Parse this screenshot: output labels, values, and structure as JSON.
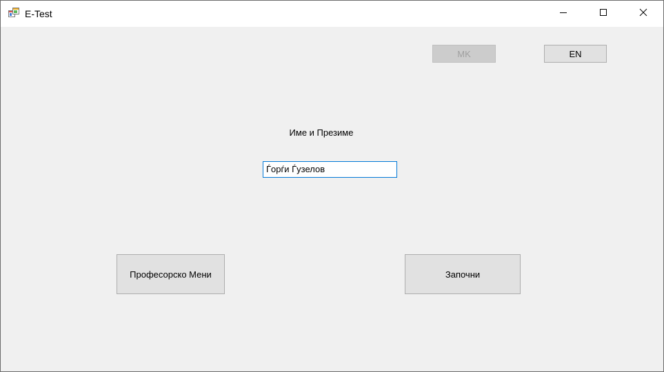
{
  "window": {
    "title": "E-Test",
    "icons": {
      "app": "windows-form-icon",
      "minimize": "minimize-icon",
      "maximize": "maximize-icon",
      "close": "close-icon"
    }
  },
  "language": {
    "mk_label": "MK",
    "mk_enabled": false,
    "en_label": "EN",
    "en_enabled": true
  },
  "form": {
    "name_label": "Име и Презиме",
    "name_value": "Ѓорѓи Ѓузелов"
  },
  "actions": {
    "professor_menu_label": "Професорско Мени",
    "start_label": "Започни"
  },
  "colors": {
    "input_focus_border": "#0078d7",
    "button_face": "#e1e1e1",
    "form_background": "#f0f0f0"
  }
}
